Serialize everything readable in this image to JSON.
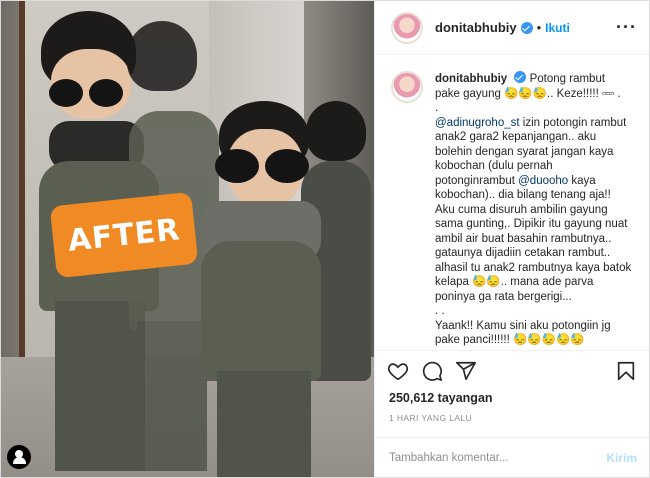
{
  "photo": {
    "badge_text": "AFTER",
    "tag_icon": "user-tag-icon"
  },
  "header": {
    "username": "donitabhubiy",
    "separator": "•",
    "follow_label": "Ikuti",
    "more_label": "···"
  },
  "caption": {
    "username": "donitabhubiy",
    "lines": [
      "Potong rambut pake gayung 😓😓😓.. Keze!!!!! ▫▫▫ .",
      ".",
      "@adinugroho_st izin potongin rambut anak2 gara2 kepanjangan.. aku bolehin dengan syarat jangan kaya kobochan (dulu pernah potonginrambut @duooho kaya kobochan).. dia bilang tenang aja!! Aku cuma disuruh ambilin gayung sama gunting,. Dipikir itu gayung nuat ambil air buat basahin rambutnya.. gataunya dijadiin cetakan rambut.. alhasil tu anak2 rambutnya kaya batok kelapa 😓😓.. mana ade parva poninya ga rata bergerigi...",
      ". .",
      "Yaank!! Kamu sini aku potongiin jg pake panci!!!!!! 😓😓😓😓😓",
      "."
    ],
    "mention_1": "@adinugroho_st",
    "mention_2": "@duooho"
  },
  "actions": {
    "like_icon": "heart-icon",
    "comment_icon": "comment-icon",
    "share_icon": "share-icon",
    "save_icon": "bookmark-icon"
  },
  "stats": {
    "views": "250,612 tayangan",
    "time": "1 HARI YANG LALU"
  },
  "comment_box": {
    "placeholder": "Tambahkan komentar...",
    "post_label": "Kirim"
  },
  "colors": {
    "accent": "#0095f6",
    "badge": "#f08a24",
    "verified": "#3897f0"
  }
}
